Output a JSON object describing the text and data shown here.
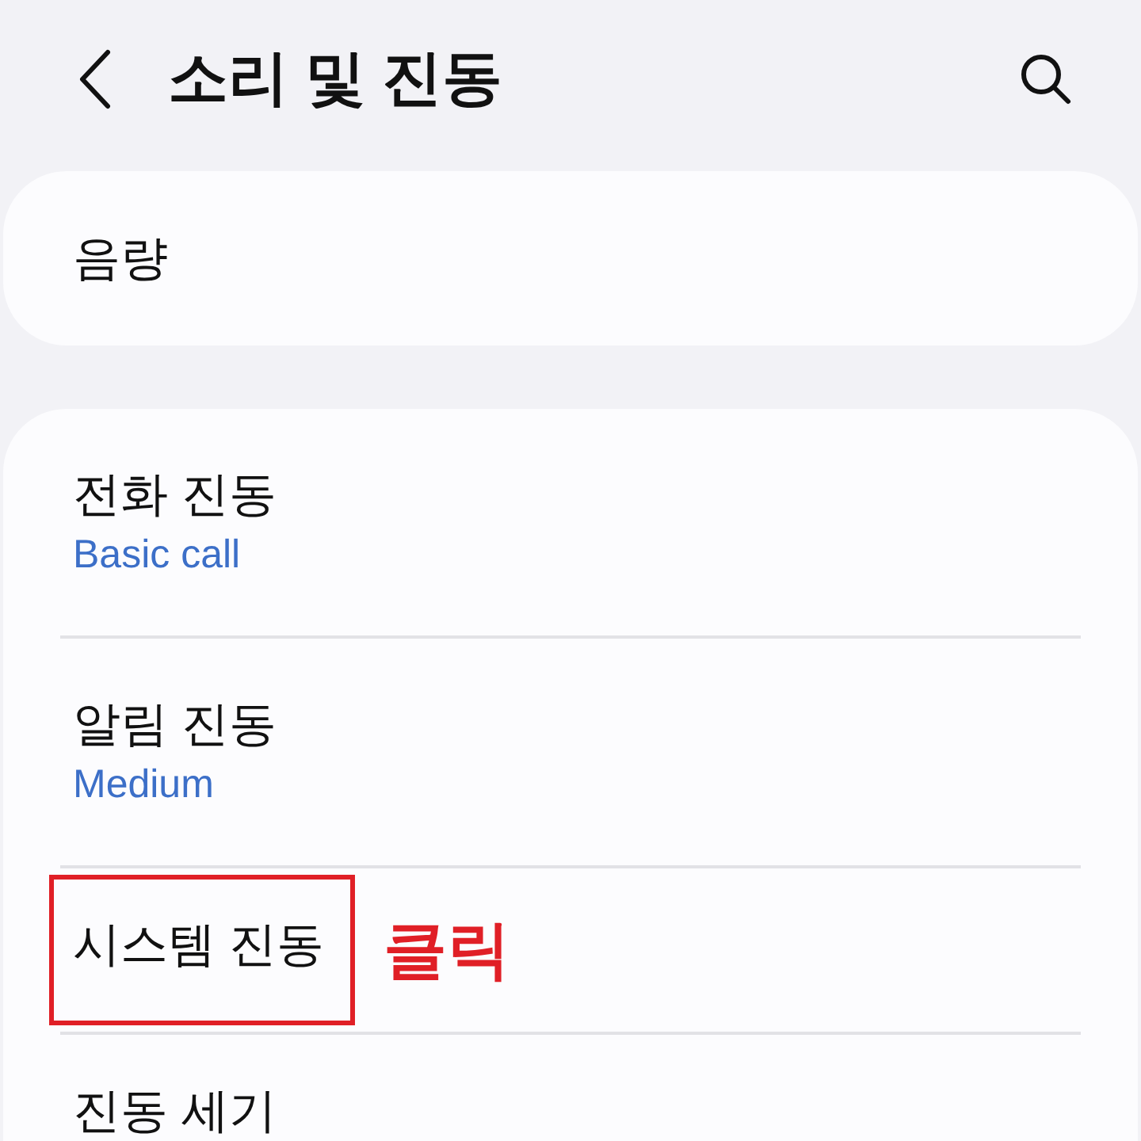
{
  "header": {
    "title": "소리 및 진동"
  },
  "volume_card": {
    "label": "음량"
  },
  "vibration_rows": [
    {
      "title": "전화 진동",
      "subtitle": "Basic call",
      "highlighted": false
    },
    {
      "title": "알림 진동",
      "subtitle": "Medium",
      "highlighted": false
    },
    {
      "title": "시스템 진동",
      "highlighted": true,
      "annotation": "클릭"
    },
    {
      "title": "진동 세기",
      "highlighted": false
    }
  ]
}
